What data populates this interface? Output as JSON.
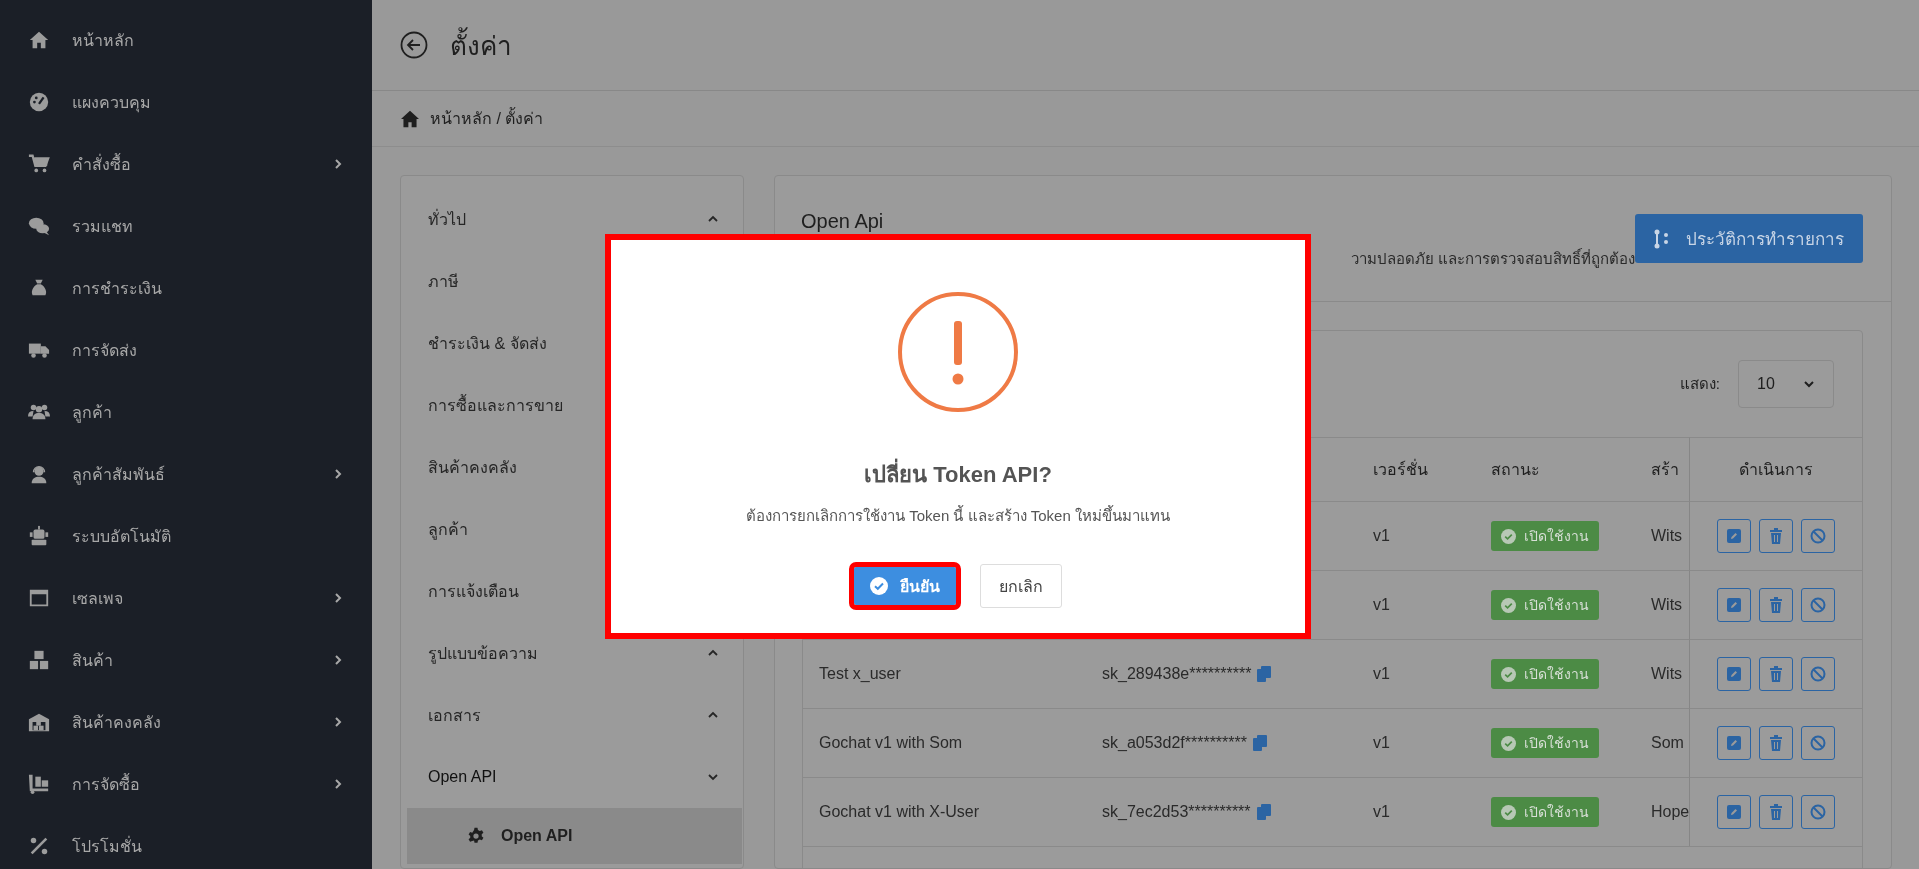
{
  "sidebar": {
    "items": [
      {
        "label": "หน้าหลัก",
        "has_submenu": false
      },
      {
        "label": "แผงควบคุม",
        "has_submenu": false
      },
      {
        "label": "คำสั่งซื้อ",
        "has_submenu": true
      },
      {
        "label": "รวมแชท",
        "has_submenu": false
      },
      {
        "label": "การชำระเงิน",
        "has_submenu": false
      },
      {
        "label": "การจัดส่ง",
        "has_submenu": false
      },
      {
        "label": "ลูกค้า",
        "has_submenu": false
      },
      {
        "label": "ลูกค้าสัมพันธ์",
        "has_submenu": true
      },
      {
        "label": "ระบบอัตโนมัติ",
        "has_submenu": false
      },
      {
        "label": "เซลเพจ",
        "has_submenu": true
      },
      {
        "label": "สินค้า",
        "has_submenu": true
      },
      {
        "label": "สินค้าคงคลัง",
        "has_submenu": true
      },
      {
        "label": "การจัดซื้อ",
        "has_submenu": true
      },
      {
        "label": "โปรโมชั่น",
        "has_submenu": false
      }
    ]
  },
  "page": {
    "title": "ตั้งค่า",
    "breadcrumb": "หน้าหลัก / ตั้งค่า"
  },
  "settings_menu": {
    "items": [
      {
        "label": "ทั่วไป",
        "expanded": false
      },
      {
        "label": "ภาษี"
      },
      {
        "label": "ชำระเงิน & จัดส่ง"
      },
      {
        "label": "การซื้อและการขาย"
      },
      {
        "label": "สินค้าคงคลัง"
      },
      {
        "label": "ลูกค้า"
      },
      {
        "label": "การแจ้งเตือน"
      },
      {
        "label": "รูปแบบข้อความ",
        "expanded": false
      },
      {
        "label": "เอกสาร",
        "expanded": false
      },
      {
        "label": "Open API",
        "expanded": true,
        "children": [
          {
            "label": "Open API",
            "selected": true
          }
        ]
      }
    ]
  },
  "panel": {
    "title": "Open Api",
    "description": "วามปลอดภัย และการตรวจสอบสิทธิ์ที่ถูกต้อง",
    "history_button": "ประวัติการทำรายการ",
    "page_size_label": "แสดง:",
    "page_size": "10",
    "table": {
      "columns": [
        "เวอร์ชั่น",
        "สถานะ",
        "สร้า",
        "ดำเนินการ"
      ],
      "rows": [
        {
          "version": "v1",
          "status": "เปิดใช้งาน",
          "creator": "Wits"
        },
        {
          "version": "v1",
          "status": "เปิดใช้งาน",
          "creator": "Wits"
        },
        {
          "name": "Test x_user",
          "token": "sk_289438e**********",
          "version": "v1",
          "status": "เปิดใช้งาน",
          "creator": "Wits"
        },
        {
          "name": "Gochat v1 with Som",
          "token": "sk_a053d2f**********",
          "version": "v1",
          "status": "เปิดใช้งาน",
          "creator": "Som"
        },
        {
          "name": "Gochat v1 with X-User",
          "token": "sk_7ec2d53**********",
          "version": "v1",
          "status": "เปิดใช้งาน",
          "creator": "Hope"
        }
      ]
    }
  },
  "dialog": {
    "highlighted": true,
    "title": "เปลี่ยน Token API?",
    "message": "ต้องการยกเลิกการใช้งาน Token นี้ และสร้าง Token ใหม่ขึ้นมาแทน",
    "confirm": {
      "label": "ยืนยัน",
      "highlighted": true
    },
    "cancel": "ยกเลิก"
  }
}
